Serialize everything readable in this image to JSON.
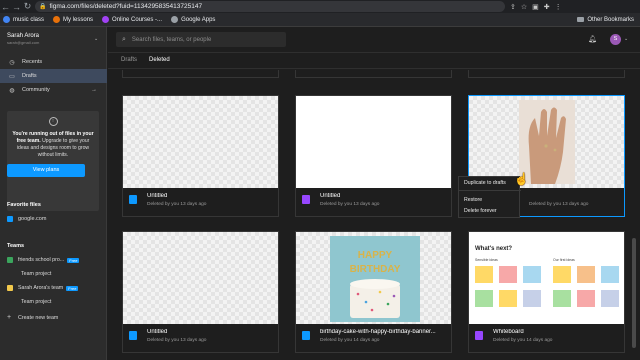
{
  "browser": {
    "url": "figma.com/files/deleted?fuid=1134295835413725147",
    "bookmarks": [
      {
        "label": "music class",
        "color": "#4285f4"
      },
      {
        "label": "My lessons",
        "color": "#e8710a"
      },
      {
        "label": "Online Courses -...",
        "color": "#a142f4"
      },
      {
        "label": "Google Apps",
        "color": "#9aa0a6"
      }
    ],
    "other_bookmarks": "Other Bookmarks"
  },
  "account": {
    "name": "Sarah Arora",
    "email": "sarah@gmail.com"
  },
  "sidebar": {
    "nav": [
      {
        "label": "Recents",
        "icon": "clock-icon"
      },
      {
        "label": "Drafts",
        "icon": "file-icon"
      },
      {
        "label": "Community",
        "icon": "globe-icon"
      }
    ],
    "promo": {
      "bold": "You're running out of files in your free team.",
      "text": "Upgrade to give your ideas and designs room to grow without limits.",
      "button": "View plans"
    },
    "favorites_title": "Favorite files",
    "favorites": [
      {
        "label": "google.com",
        "color": "#0d99ff"
      }
    ],
    "teams_title": "Teams",
    "teams": [
      {
        "label": "friends school pro...",
        "badge": "Free",
        "color": "#3ba55d",
        "sub": false
      },
      {
        "label": "Team project",
        "badge": "",
        "color": "",
        "sub": true
      },
      {
        "label": "Sarah Arora's team",
        "badge": "Free",
        "color": "#f2c94c",
        "sub": false
      },
      {
        "label": "Team project",
        "badge": "",
        "color": "",
        "sub": true
      },
      {
        "label": "Create new team",
        "badge": "",
        "color": "",
        "sub": false,
        "plus": true
      }
    ]
  },
  "search": {
    "placeholder": "Search files, teams, or people"
  },
  "avatar_initial": "S",
  "tabs": [
    {
      "label": "Drafts",
      "active": false
    },
    {
      "label": "Deleted",
      "active": true
    }
  ],
  "files": [
    {
      "name": "Untitled",
      "date": "Deleted by you 13 days ago",
      "type": "design",
      "thumb": "checker"
    },
    {
      "name": "Untitled",
      "date": "Deleted by you 13 days ago",
      "type": "figjam",
      "thumb": "white"
    },
    {
      "name": "Untitled",
      "date": "Deleted by you 13 days ago",
      "type": "design",
      "thumb": "hand"
    },
    {
      "name": "Untitled",
      "date": "Deleted by you 13 days ago",
      "type": "design",
      "thumb": "checker"
    },
    {
      "name": "birthday-cake-with-happy-birthday-banner...",
      "date": "Deleted by you 14 days ago",
      "type": "design",
      "thumb": "cake"
    },
    {
      "name": "Whiteboard",
      "date": "Deleted by you 14 days ago",
      "type": "figjam",
      "thumb": "whiteboard"
    }
  ],
  "cake_text": [
    "HAPPY",
    "BIRTHDAY"
  ],
  "whiteboard": {
    "title": "What's next?",
    "left_label": "Sensible ideas",
    "right_label": "Our first ideas"
  },
  "context_menu": {
    "duplicate": "Duplicate to drafts",
    "restore": "Restore",
    "delete": "Delete forever"
  },
  "icon_colors": {
    "design": "#0d99ff",
    "figjam": "#9747ff"
  }
}
